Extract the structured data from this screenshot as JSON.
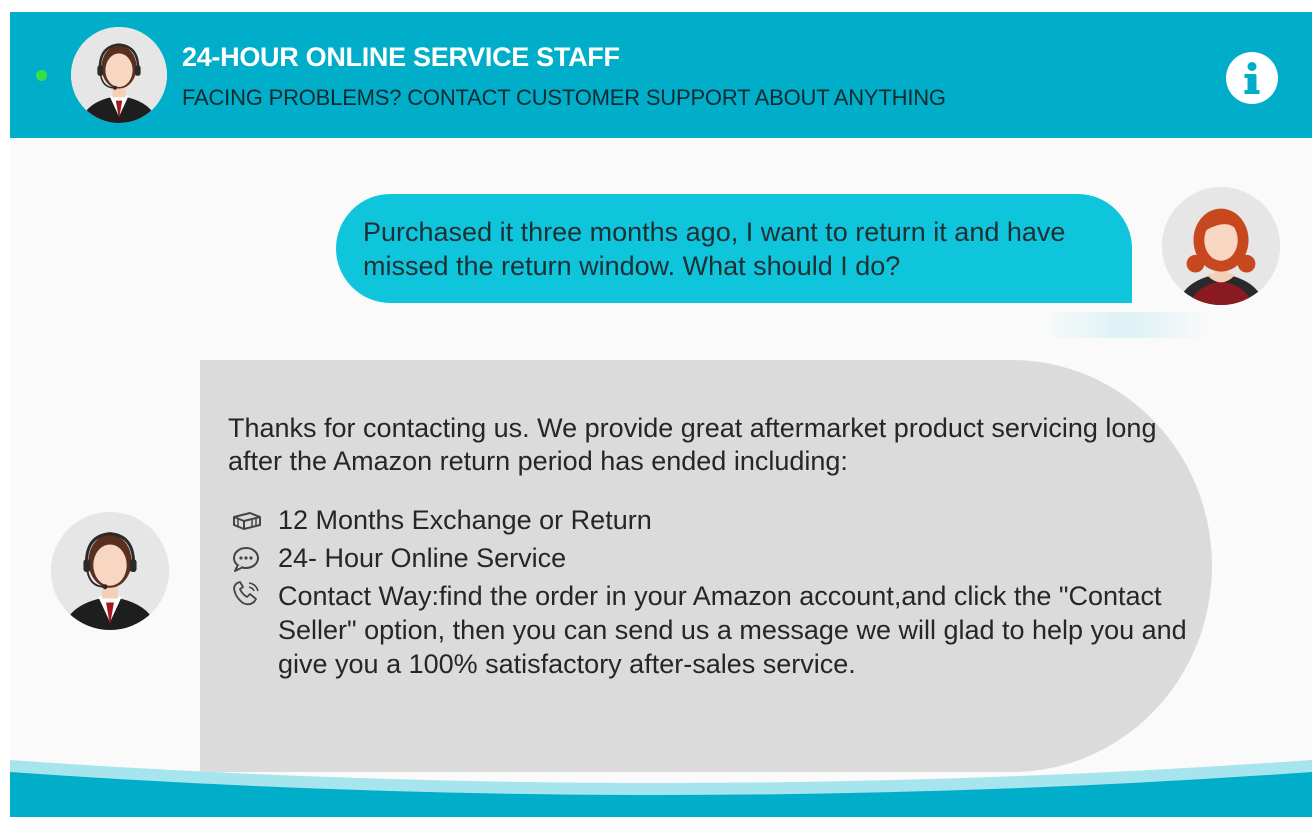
{
  "header": {
    "title": "24-HOUR ONLINE SERVICE STAFF",
    "subtitle": "FACING PROBLEMS? CONTACT CUSTOMER SUPPORT ABOUT ANYTHING",
    "status": "online",
    "info_icon": "info-icon"
  },
  "messages": {
    "user": {
      "text": "Purchased it three months ago, I want to return it and have missed the return window. What should I do?"
    },
    "agent": {
      "intro": "Thanks for contacting us. We provide great aftermarket product servicing long after the Amazon return period has ended including:",
      "features": [
        {
          "icon": "money-icon",
          "text": "12 Months Exchange or Return"
        },
        {
          "icon": "chat-icon",
          "text": "24- Hour Online Service"
        },
        {
          "icon": "phone-icon",
          "text": "Contact Way:find the order in your Amazon account,and click the \"Contact Seller\" option, then you can send us a message we will glad to help you and give you a 100% satisfactory after-sales service."
        }
      ]
    }
  },
  "colors": {
    "header_bg": "#00aec9",
    "user_bubble": "#0fc5dc",
    "agent_bubble": "#dbdbdb",
    "status_dot": "#35e04a"
  }
}
